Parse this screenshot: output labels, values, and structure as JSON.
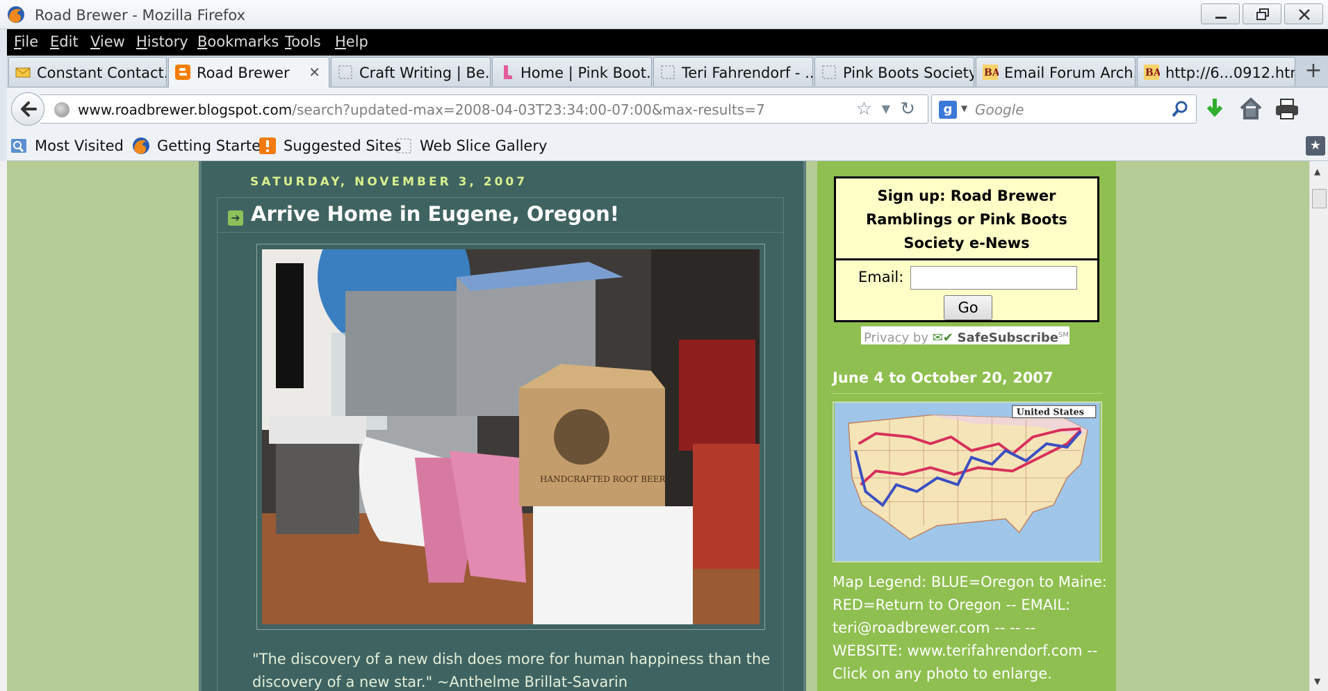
{
  "window": {
    "title": "Road Brewer - Mozilla Firefox"
  },
  "menu": [
    "File",
    "Edit",
    "View",
    "History",
    "Bookmarks",
    "Tools",
    "Help"
  ],
  "tabs": [
    {
      "label": "Constant Contact..."
    },
    {
      "label": "Road Brewer",
      "active": true
    },
    {
      "label": "Craft Writing | Be..."
    },
    {
      "label": "Home | Pink Boot..."
    },
    {
      "label": "Teri Fahrendorf - ..."
    },
    {
      "label": "Pink Boots Society"
    },
    {
      "label": "Email Forum Arch..."
    },
    {
      "label": "http://6...0912.htm"
    }
  ],
  "newtab_label": "+",
  "address": {
    "domain": "www.roadbrewer.blogspot.com",
    "path": "/search?updated-max=2008-04-03T23:34:00-07:00&max-results=7"
  },
  "search": {
    "placeholder": "Google",
    "engine_letter": "g"
  },
  "bookmarks": [
    "Most Visited",
    "Getting Started",
    "Suggested Sites",
    "Web Slice Gallery"
  ],
  "post": {
    "date": "SATURDAY, NOVEMBER 3, 2007",
    "title": "Arrive Home in Eugene, Oregon!",
    "quote_line1": "\"The discovery of a new dish does more for human happiness than the",
    "quote_line2": "discovery of a new star.\" ~Anthelme Brillat-Savarin",
    "photo_box_text": "HANDCRAFTED ROOT BEER"
  },
  "sidebar": {
    "signup_line1": "Sign up: Road Brewer",
    "signup_line2": "Ramblings or Pink Boots",
    "signup_line3": "Society e-News",
    "email_label": "Email:",
    "go_label": "Go",
    "privacy_by": "Privacy by",
    "safesubscribe": "SafeSubscribe",
    "safesubscribe_sup": "SM",
    "heading": "June 4 to October 20, 2007",
    "map_label": "United States",
    "legend_lines": [
      "Map Legend: BLUE=Oregon to Maine:",
      "RED=Return to Oregon -- EMAIL:",
      "teri@roadbrewer.com -- -- --",
      "WEBSITE: www.terifahrendorf.com --",
      "Click on any photo to enlarge."
    ]
  },
  "colors": {
    "page_bg": "#b5cc96",
    "post_bg": "#3f6361",
    "date_color": "#d8f08f",
    "sidebar_bg": "#8fbf50",
    "signup_bg": "#ffffc8",
    "route_blue": "#3a4fc2",
    "route_red": "#d8305a"
  }
}
